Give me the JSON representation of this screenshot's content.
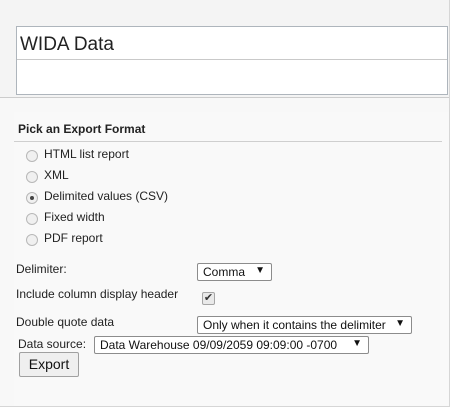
{
  "report": {
    "name_value": "WIDA Data"
  },
  "export_format": {
    "heading": "Pick an Export Format",
    "options": [
      {
        "label": "HTML list report",
        "checked": false
      },
      {
        "label": "XML",
        "checked": false
      },
      {
        "label": "Delimited values (CSV)",
        "checked": true
      },
      {
        "label": "Fixed width",
        "checked": false
      },
      {
        "label": "PDF report",
        "checked": false
      }
    ]
  },
  "settings": {
    "delimiter_label": "Delimiter:",
    "delimiter_value": "Comma",
    "header_label": "Include column display header",
    "header_checked": true,
    "quote_label": "Double quote data",
    "quote_value": "Only when it contains the delimiter",
    "source_label": "Data source:",
    "source_value": "Data Warehouse 09/09/2059 09:09:00 -0700"
  },
  "actions": {
    "export_label": "Export"
  },
  "icons": {
    "dropdown": "chevron-down-icon",
    "check": "checkmark-icon"
  }
}
